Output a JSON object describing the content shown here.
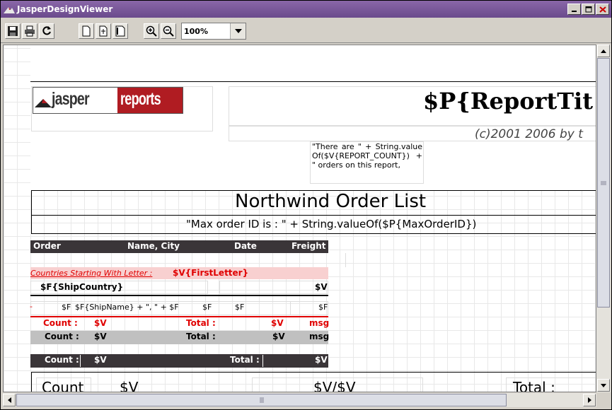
{
  "window": {
    "title": "JasperDesignViewer",
    "controls": {
      "minimize": "_",
      "maximize": "□",
      "close": "×"
    }
  },
  "toolbar": {
    "buttons": [
      "save-icon",
      "print-icon",
      "reload-icon",
      "page-actual-icon",
      "page-fit-width-icon",
      "page-fit-icon",
      "zoom-in-icon",
      "zoom-out-icon"
    ],
    "zoom_value": "100%"
  },
  "report": {
    "logo_left": "jasper",
    "logo_right": "reports",
    "title_field": "$P{ReportTit",
    "copyright": "(c)2001 2006 by t",
    "count_expression": "\"There are \" + String.valueOf($V{REPORT_COUNT}) + \" orders on this report,",
    "main_title": "Northwind Order List",
    "max_order_expression": "\"Max order ID is : \" + String.valueOf($P{MaxOrderID})",
    "column_headers": {
      "order": "Order",
      "name_city": "Name, City",
      "date": "Date",
      "freight": "Freight"
    },
    "group_label": "Countries Starting With Letter :",
    "group_value": "$V{FirstLetter}",
    "ship_country": "$F{ShipCountry}",
    "ship_country_right": "$V",
    "detail": {
      "mark": "-",
      "order": "$F",
      "name_expr": "$F{ShipName} + \", \" + $F",
      "date1": "$F",
      "date2": "$F",
      "freight": "$F"
    },
    "footer1": {
      "count": "Count :",
      "count_v": "$V",
      "total": "Total :",
      "total_v": "$V",
      "msg": "msg"
    },
    "footer2": {
      "count": "Count :",
      "count_v": "$V",
      "total": "Total :",
      "total_v": "$V",
      "msg": "msg"
    },
    "footer3": {
      "count": "Count :",
      "count_v": "$V",
      "total": "Total :",
      "total_v": "$V"
    },
    "summary": {
      "count": "Count",
      "count_v": "$V",
      "ratio": "$V/$V",
      "total": "Total :"
    }
  },
  "colors": {
    "title_purple": "#6a4a8c",
    "header_dark": "#3a3538",
    "group_pink": "#f8d0d0",
    "red_text": "#e00000",
    "footer_gray": "#c0c0c0",
    "logo_red": "#b01c22"
  }
}
